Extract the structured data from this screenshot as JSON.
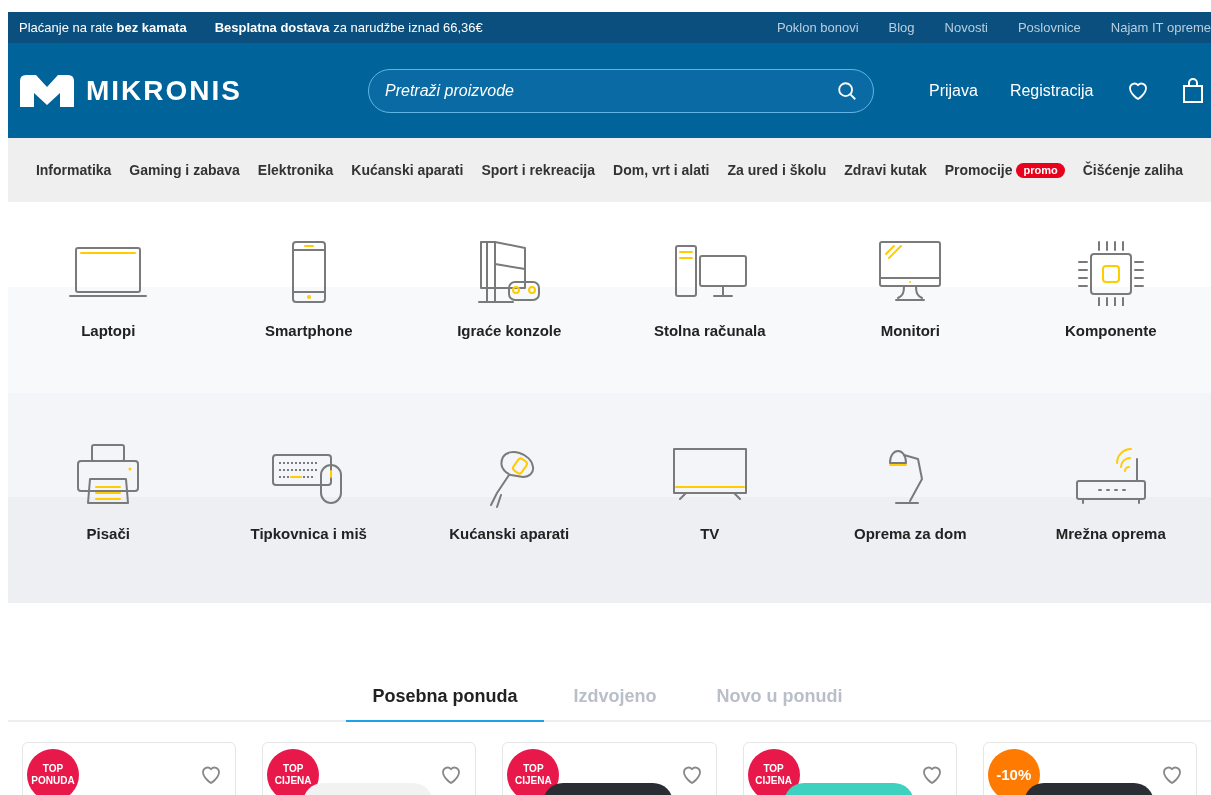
{
  "top_bar": {
    "left": [
      "Plaćanje na rate **bez kamata**",
      "**Besplatna dostava** za narudžbe iznad 66,36€"
    ],
    "links": [
      "Poklon bonovi",
      "Blog",
      "Novosti",
      "Poslovnice",
      "Najam IT opreme"
    ]
  },
  "header": {
    "logo": "MIKRONIS",
    "search": {
      "placeholder": "Pretraži proizvode"
    },
    "links": [
      "Prijava",
      "Registracija"
    ]
  },
  "nav": [
    {
      "label": "Informatika"
    },
    {
      "label": "Gaming i zabava"
    },
    {
      "label": "Elektronika"
    },
    {
      "label": "Kućanski aparati"
    },
    {
      "label": "Sport i rekreacija"
    },
    {
      "label": "Dom, vrt i alati"
    },
    {
      "label": "Za ured i školu"
    },
    {
      "label": "Zdravi kutak"
    },
    {
      "label": "Promocije",
      "badge": "promo"
    },
    {
      "label": "Čišćenje zaliha"
    }
  ],
  "categories": [
    {
      "kind": "laptop",
      "label": "Laptopi"
    },
    {
      "kind": "phone",
      "label": "Smartphone"
    },
    {
      "kind": "console",
      "label": "Igraće konzole"
    },
    {
      "kind": "desktop",
      "label": "Stolna računala"
    },
    {
      "kind": "monitor",
      "label": "Monitori"
    },
    {
      "kind": "chip",
      "label": "Komponente"
    },
    {
      "kind": "printer",
      "label": "Pisači"
    },
    {
      "kind": "keyboard",
      "label": "Tipkovnica i miš"
    },
    {
      "kind": "mixer",
      "label": "Kućanski aparati"
    },
    {
      "kind": "tv",
      "label": "TV"
    },
    {
      "kind": "lamp",
      "label": "Oprema za dom"
    },
    {
      "kind": "router",
      "label": "Mrežna oprema"
    }
  ],
  "tabs": [
    {
      "label": "Posebna ponuda",
      "selected": true
    },
    {
      "label": "Izdvojeno",
      "selected": false
    },
    {
      "label": "Novo u ponudi",
      "selected": false
    }
  ],
  "products": [
    {
      "badge": {
        "kind": "top",
        "lines": [
          "TOP",
          "PONUDA"
        ]
      }
    },
    {
      "badge": {
        "kind": "top",
        "lines": [
          "TOP",
          "CIJENA"
        ]
      }
    },
    {
      "badge": {
        "kind": "top",
        "lines": [
          "TOP",
          "CIJENA"
        ]
      }
    },
    {
      "badge": {
        "kind": "top",
        "lines": [
          "TOP",
          "CIJENA"
        ]
      }
    },
    {
      "badge": {
        "kind": "discount",
        "lines": [
          "-10%"
        ]
      }
    }
  ]
}
